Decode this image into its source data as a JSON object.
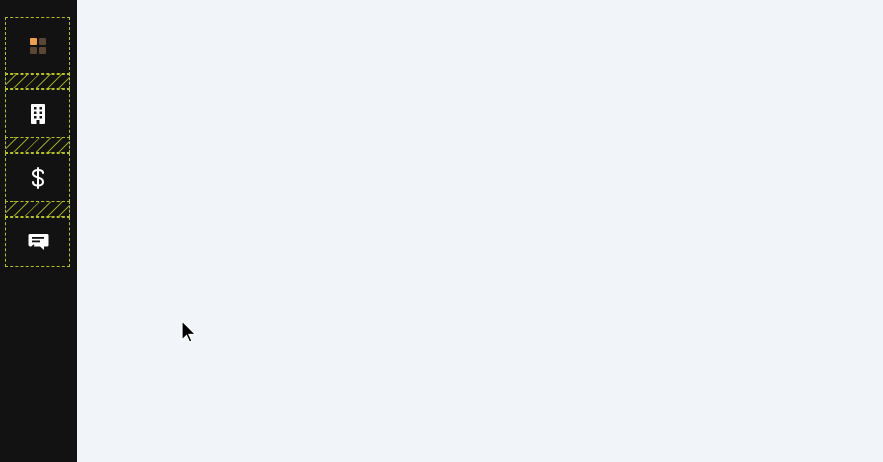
{
  "sidebar": {
    "items": [
      {
        "id": "dashboard",
        "icon": "dashboard-grid-icon"
      },
      {
        "id": "buildings",
        "icon": "building-icon"
      },
      {
        "id": "finance",
        "icon": "dollar-icon"
      },
      {
        "id": "support",
        "icon": "chat-icon"
      }
    ]
  },
  "colors": {
    "sidebar_bg": "#121212",
    "main_bg": "#f1f4f8",
    "accent_orange": "#f0a04b",
    "outline": "#b5c21a"
  }
}
